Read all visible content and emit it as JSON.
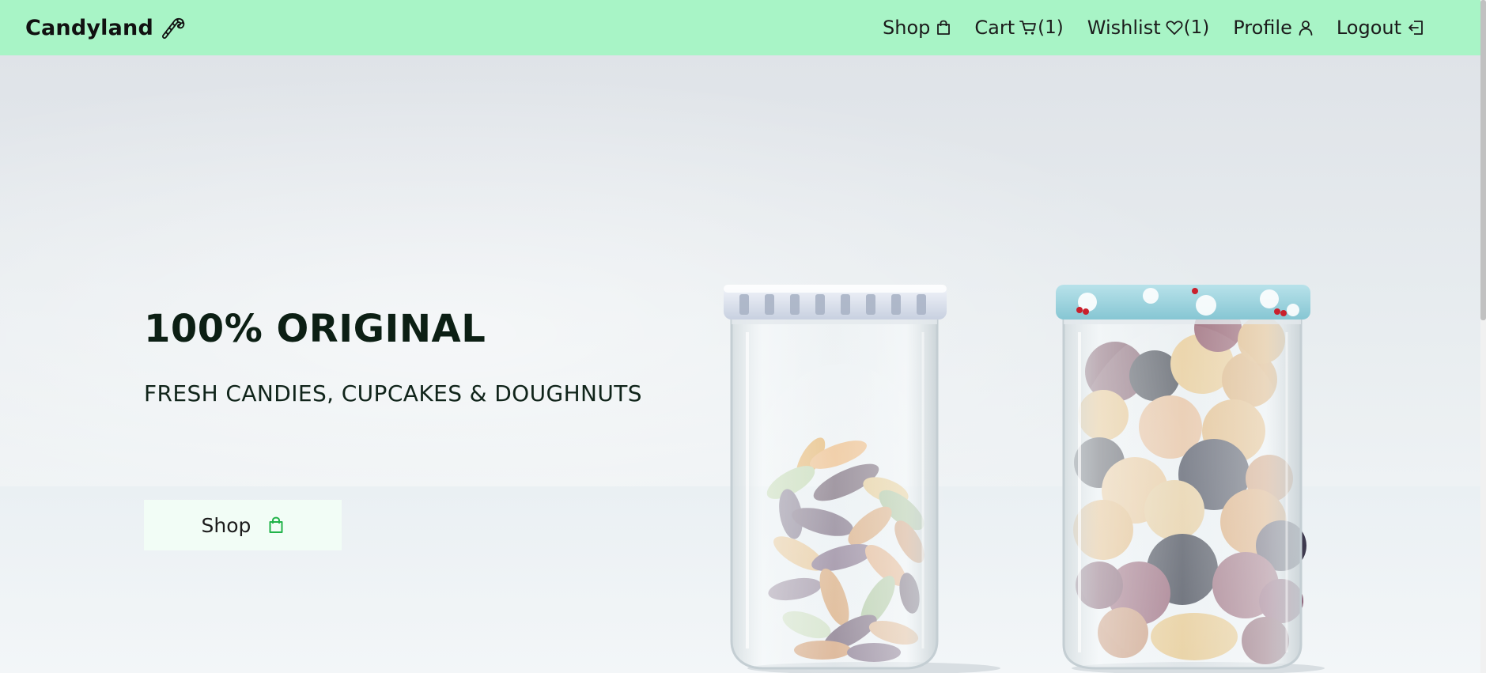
{
  "brand": {
    "name": "Candyland",
    "icon": "candy-cane-icon"
  },
  "nav": {
    "shop": {
      "label": "Shop",
      "icon": "shopping-bag-icon"
    },
    "cart": {
      "label": "Cart",
      "icon": "cart-icon",
      "count": "(1)"
    },
    "wishlist": {
      "label": "Wishlist",
      "icon": "heart-icon",
      "count": "(1)"
    },
    "profile": {
      "label": "Profile",
      "icon": "user-icon"
    },
    "logout": {
      "label": "Logout",
      "icon": "logout-icon"
    }
  },
  "hero": {
    "headline": "100% ORIGINAL",
    "subline": "FRESH CANDIES, CUPCAKES & DOUGHNUTS",
    "cta_label": "Shop",
    "cta_icon": "shopping-bag-icon",
    "image": "candy-jars-photo"
  },
  "colors": {
    "navbar_bg": "#a8f4c6",
    "cta_bg": "#f2fdf6",
    "accent_green": "#22b34a",
    "text_dark": "#0c1f14"
  }
}
